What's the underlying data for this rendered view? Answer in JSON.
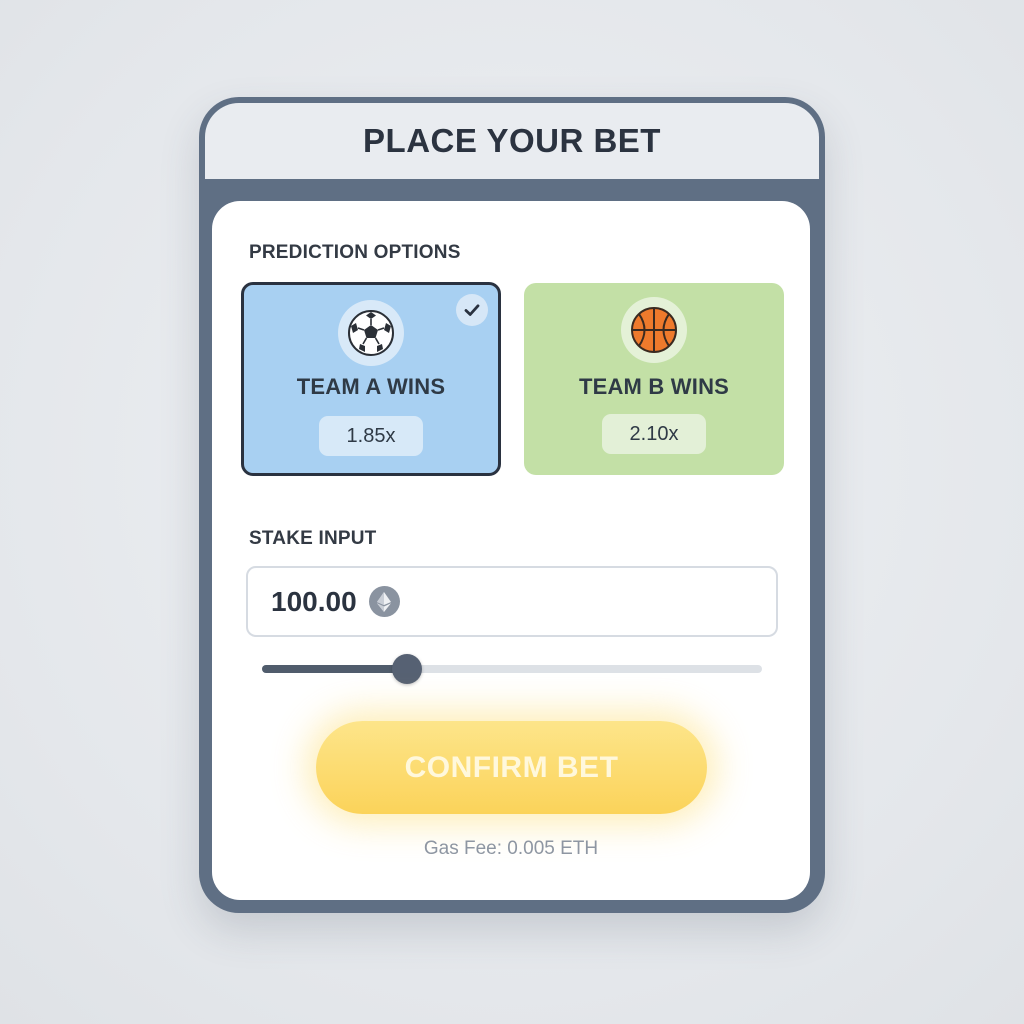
{
  "header": {
    "title": "PLACE YOUR BET"
  },
  "prediction": {
    "label": "PREDICTION OPTIONS",
    "options": [
      {
        "title": "TEAM A WINS",
        "odds": "1.85x",
        "icon": "soccer-ball-icon",
        "selected": true,
        "color": "#a8d0f2"
      },
      {
        "title": "TEAM B WINS",
        "odds": "2.10x",
        "icon": "basketball-icon",
        "selected": false,
        "color": "#c3e0a6"
      }
    ]
  },
  "stake": {
    "label": "STAKE INPUT",
    "value": "100.00",
    "currency_icon": "ethereum-icon",
    "slider_fraction": 0.29
  },
  "confirm": {
    "label": "CONFIRM BET",
    "color": "#fbd35a"
  },
  "gas_fee": "Gas Fee: 0.005 ETH"
}
